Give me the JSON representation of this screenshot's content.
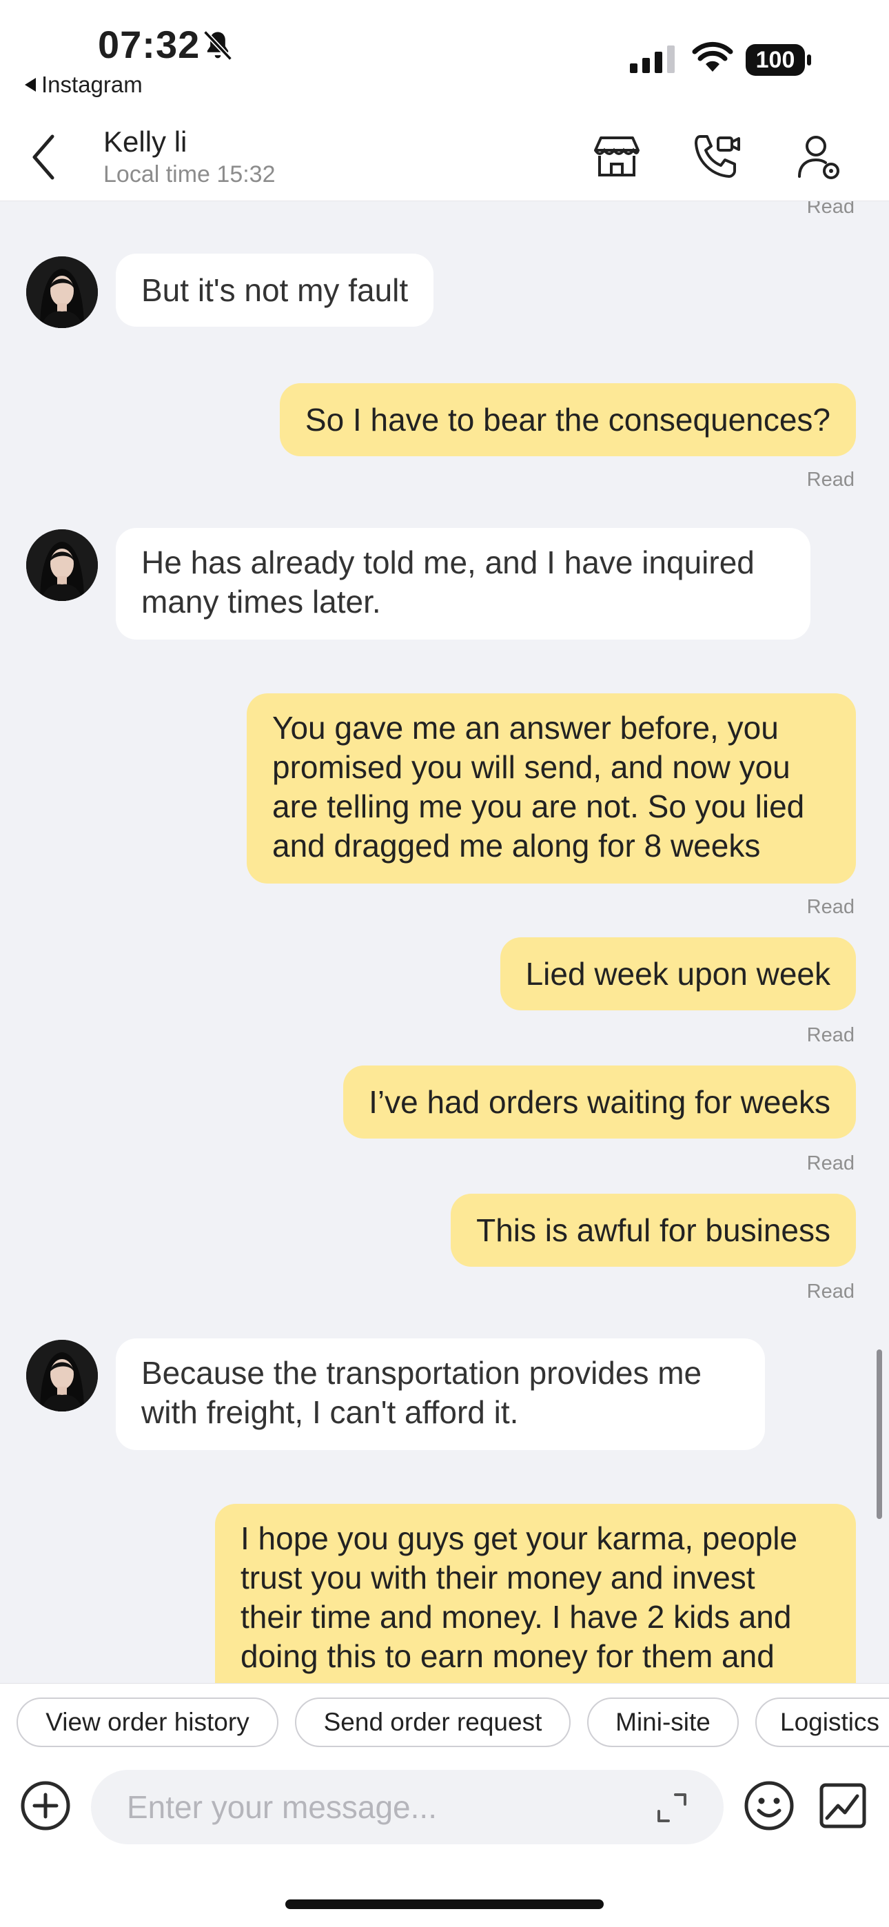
{
  "status_bar": {
    "time": "07:32",
    "back_app": "Instagram",
    "battery": "100"
  },
  "header": {
    "name": "Kelly li",
    "local_time": "Local time 15:32"
  },
  "messages": [
    {
      "side": "out",
      "status": "Read"
    },
    {
      "side": "in",
      "text": "But it's not my fault"
    },
    {
      "side": "out",
      "text": "So I have to bear the consequences?",
      "status": "Read"
    },
    {
      "side": "in",
      "lines": [
        "He has already told me, and I have inquired",
        "many times later."
      ]
    },
    {
      "side": "out",
      "lines": [
        "You gave me an answer before, you",
        "promised you will send, and now you",
        "are telling me you are not. So you lied",
        "and dragged me along for 8 weeks"
      ],
      "status": "Read"
    },
    {
      "side": "out",
      "text": "Lied week upon week",
      "status": "Read"
    },
    {
      "side": "out",
      "text": "I’ve had orders waiting for weeks",
      "status": "Read"
    },
    {
      "side": "out",
      "text": "This is awful for business",
      "status": "Read"
    },
    {
      "side": "in",
      "lines": [
        "Because the transportation provides me",
        "with freight, I can't afford it."
      ]
    },
    {
      "side": "out",
      "lines": [
        "I hope you guys get your karma, people",
        "trust you with their money and invest",
        "their time and money. I have 2 kids and",
        "doing this to earn money for them and"
      ]
    }
  ],
  "quick_replies": [
    "View order history",
    "Send order request",
    "Mini-site",
    "Logistics"
  ],
  "composer": {
    "placeholder": "Enter your message..."
  },
  "icons": {
    "bell": "bell-slash-icon",
    "back": "chevron-left-icon",
    "store": "store-icon",
    "call": "video-call-icon",
    "profile": "user-settings-icon",
    "plus": "plus-circle-icon",
    "expand": "expand-icon",
    "emoji": "emoji-icon",
    "image": "image-icon"
  },
  "colors": {
    "bubble_out": "#fde896",
    "bubble_in": "#ffffff",
    "chat_bg": "#f1f2f6"
  }
}
